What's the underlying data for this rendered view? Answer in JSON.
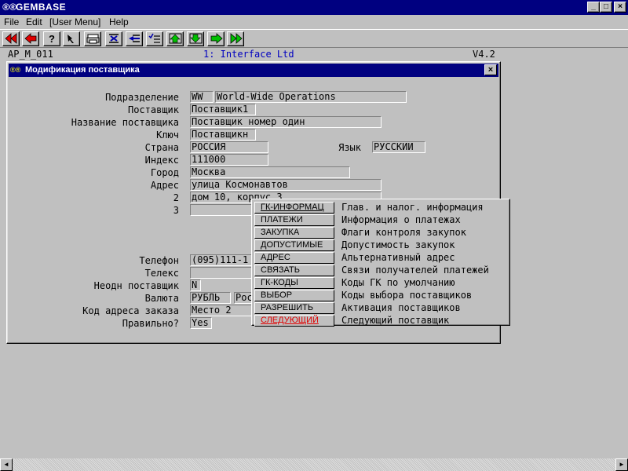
{
  "window": {
    "title": "GEMBASE",
    "icon": "gembase-logo-icon",
    "app_glyph": "®®",
    "min": "_",
    "max": "□",
    "close": "×"
  },
  "menubar": {
    "items": [
      {
        "label": "File"
      },
      {
        "label": "Edit"
      },
      {
        "label": "[User Menu]"
      },
      {
        "label": "Help"
      }
    ]
  },
  "toolbar": {
    "buttons": [
      {
        "icon": "first-record-icon"
      },
      {
        "icon": "previous-record-icon"
      },
      {
        "icon": "help-icon"
      },
      {
        "icon": "pointer-icon"
      },
      {
        "icon": "print-icon"
      },
      {
        "icon": "delete-record-icon"
      },
      {
        "icon": "insert-record-icon"
      },
      {
        "icon": "list-icon"
      },
      {
        "icon": "page-up-icon"
      },
      {
        "icon": "page-down-icon"
      },
      {
        "icon": "next-record-icon"
      },
      {
        "icon": "last-record-icon"
      }
    ],
    "help_glyph": "?"
  },
  "status": {
    "code": "AP_M_011",
    "company": "1: Interface Ltd",
    "version": "V4.2"
  },
  "dialog": {
    "title": "Модификация поставщика",
    "close": "×",
    "fields": {
      "division_label": "Подразделение",
      "division_code": "WW",
      "division_name": "World-Wide Operations",
      "supplier_label": "Поставщик",
      "supplier_value": "Поставщик1",
      "supplier_name_label": "Название поставщика",
      "supplier_name_value": "Поставщик номер один",
      "key_label": "Ключ",
      "key_value": "Поставщикн",
      "country_label": "Страна",
      "country_value": "РОССИЯ",
      "language_label": "Язык",
      "language_value": "РУССКИЙ",
      "index_label": "Индекс",
      "index_value": "111000",
      "city_label": "Город",
      "city_value": "Москва",
      "address_label": "Адрес",
      "address_value": "улица Космонавтов",
      "address2_label": "2",
      "address2_value": "дом 10, корпус 3",
      "address3_label": "3",
      "address3_value": "",
      "phone_label": "Телефон",
      "phone_value": "(095)111-1",
      "telex_label": "Телекс",
      "telex_value": "",
      "one_time_label": "Неодн поставщик",
      "one_time_value": "N",
      "currency_label": "Валюта",
      "currency_code": "РУБЛЬ",
      "currency_name": "Рос",
      "order_address_label": "Код адреса заказа",
      "order_address_value": "Место 2",
      "correct_label": "Правильно?",
      "correct_value": "Yes"
    }
  },
  "popup_menu": {
    "items": [
      {
        "label": "ГК-ИНФОРМАЦ",
        "desc": "Глав. и налог. информация"
      },
      {
        "label": "ПЛАТЕЖИ",
        "desc": "Информация о платежах"
      },
      {
        "label": "ЗАКУПКА",
        "desc": "Флаги контроля закупок"
      },
      {
        "label": "ДОПУСТИМЫЕ",
        "desc": "Допустимость закупок"
      },
      {
        "label": "АДРЕС",
        "desc": "Альтернативный адрес"
      },
      {
        "label": "СВЯЗАТЬ",
        "desc": "Связи получателей платежей"
      },
      {
        "label": "ГК-КОДЫ",
        "desc": "Коды ГК по умолчанию"
      },
      {
        "label": "ВЫБОР",
        "desc": "Коды выбора поставщиков"
      },
      {
        "label": "РАЗРЕШИТЬ",
        "desc": "Активация поставщиков"
      },
      {
        "label": "СЛЕДУЮЩИЙ",
        "desc": "Следующий поставщик"
      }
    ],
    "highlight_color": "#e00000"
  },
  "scrollbar": {
    "left": "◄",
    "right": "►"
  }
}
